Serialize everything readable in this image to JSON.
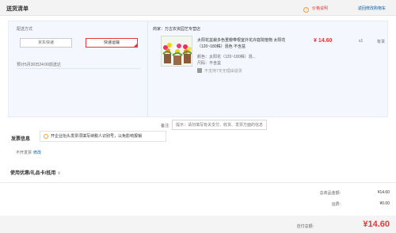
{
  "header": {
    "title": "送货清单",
    "price_help": "价格说明",
    "back_to_cart": "返回修改购物车"
  },
  "shipping": {
    "label": "配送方式",
    "options": [
      "京东快递",
      "快递运输"
    ],
    "selected": "快递运输",
    "eta": "预计5月30日24:00前送达"
  },
  "item": {
    "store": "商家：万古农资园艺专营店",
    "name": "太阳花盆栽多色重瓣带根室外花卉庭院植物 太阳花（120~180株）混色 不含盆",
    "price": "¥ 14.60",
    "qty": "x1",
    "stock": "有货",
    "color": "颜色：太阳花（120~180株）混...",
    "size": "尺码：不含盆",
    "no_return": "不支持7天无理由退货"
  },
  "note": {
    "label": "备注:",
    "placeholder": "提示：请勿填写有关支付、收货、发票方面的信息"
  },
  "invoice": {
    "title": "发票信息",
    "tip": "开企业抬头发票须填写纳税人识别号，以免影响报销",
    "status": "不开发票",
    "edit": "修改"
  },
  "coupons": {
    "title": "使用优惠/礼品卡/抵用",
    "chevron": "∨"
  },
  "summary": {
    "total_label": "总商品金额:",
    "total_value": "¥14.60",
    "freight_label": "运费:",
    "freight_value": "¥0.00",
    "payable_label": "应付总额:",
    "payable_value": "¥14.60"
  },
  "colors": {
    "accent": "#e4393c",
    "link": "#005ea7",
    "block_bg": "#f4f8fe"
  }
}
